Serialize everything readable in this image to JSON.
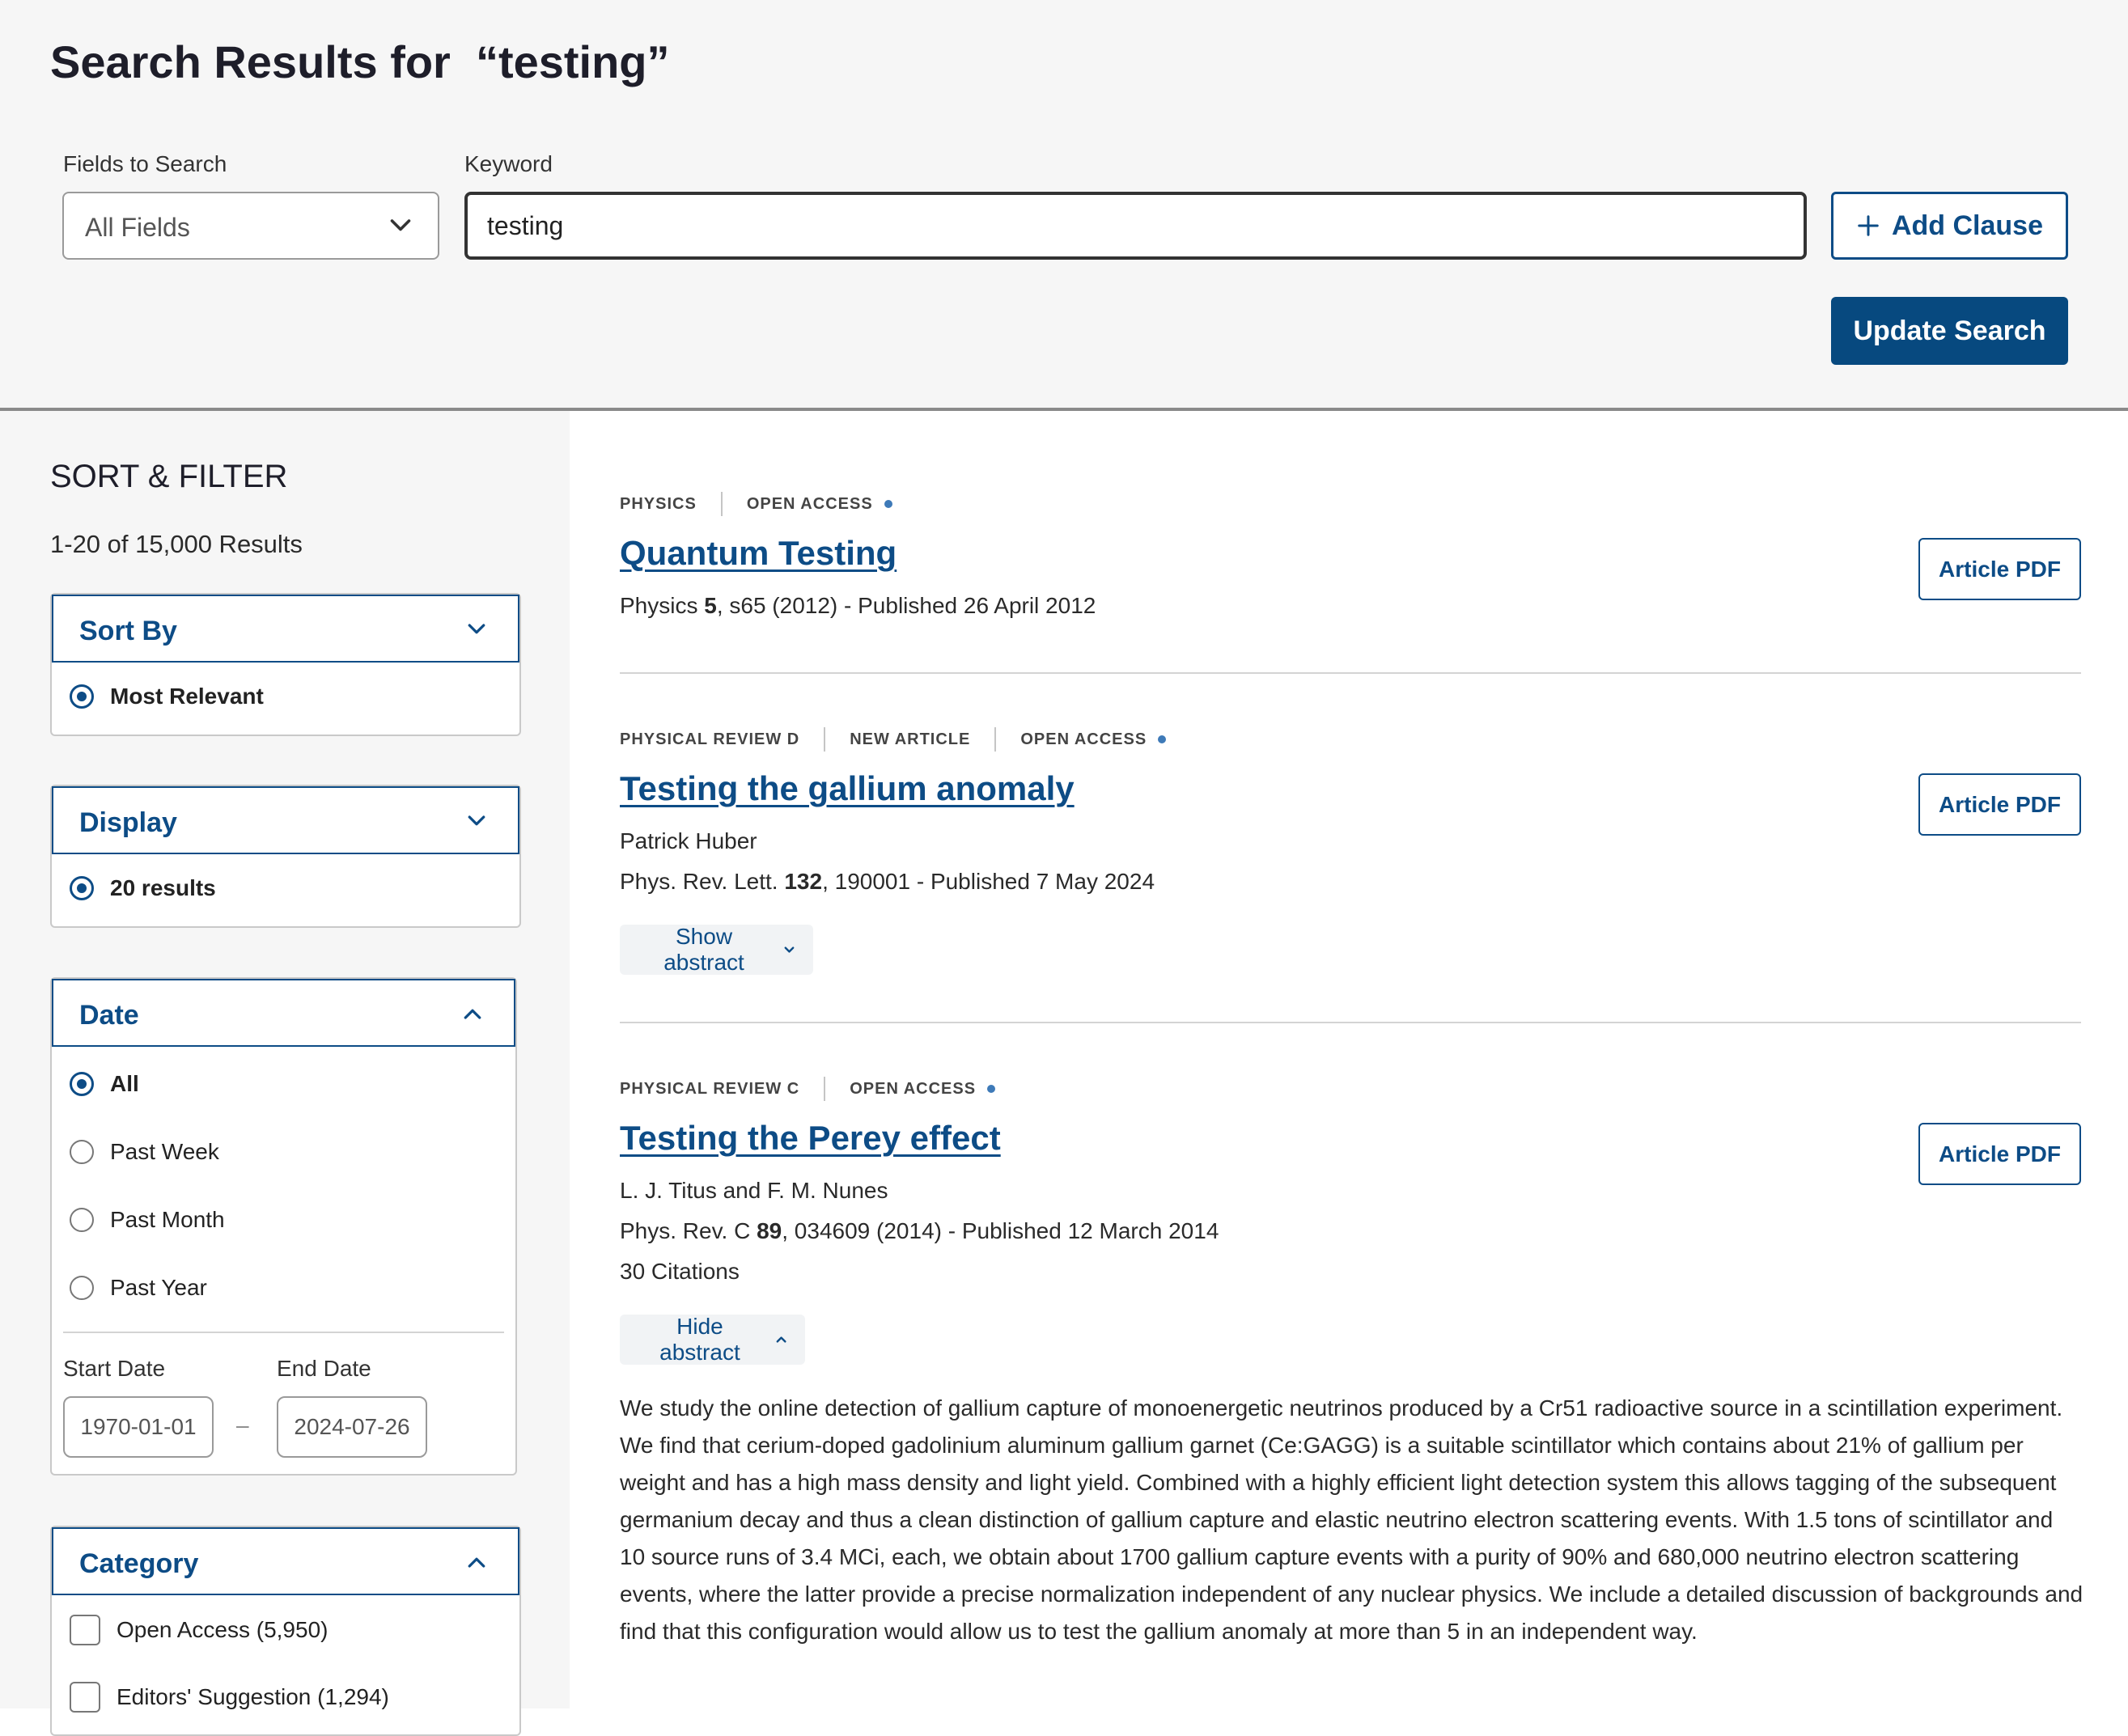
{
  "header": {
    "title": "Search Results for  “testing”",
    "fields_label": "Fields to Search",
    "fields_value": "All Fields",
    "keyword_label": "Keyword",
    "keyword_value": "testing",
    "add_clause": "Add Clause",
    "update_search": "Update Search"
  },
  "sidebar": {
    "title": "SORT & FILTER",
    "result_count": "1-20 of 15,000 Results",
    "sort": {
      "label": "Sort By",
      "option": "Most Relevant"
    },
    "display": {
      "label": "Display",
      "option": "20 results"
    },
    "date": {
      "label": "Date",
      "options": [
        "All",
        "Past Week",
        "Past Month",
        "Past Year"
      ],
      "selected": "All",
      "start_label": "Start Date",
      "end_label": "End Date",
      "start_value": "1970-01-01",
      "end_value": "2024-07-26",
      "range_sep": "–"
    },
    "category": {
      "label": "Category",
      "options": [
        "Open Access (5,950)",
        "Editors' Suggestion (1,294)"
      ]
    }
  },
  "results": [
    {
      "tags": [
        "PHYSICS",
        "OPEN ACCESS"
      ],
      "title": "Quantum Testing",
      "journal": "Physics ",
      "volume": "5",
      "citation": ", s65 (2012) - Published 26 April 2012",
      "pdf": "Article PDF"
    },
    {
      "tags": [
        "PHYSICAL REVIEW D",
        "NEW ARTICLE",
        "OPEN ACCESS"
      ],
      "title": "Testing the gallium anomaly",
      "authors": "Patrick Huber",
      "journal": "Phys. Rev. Lett. ",
      "volume": "132",
      "citation": ", 190001 - Published 7 May 2024",
      "abstract_toggle": "Show abstract",
      "pdf": "Article PDF"
    },
    {
      "tags": [
        "PHYSICAL REVIEW C",
        "OPEN ACCESS"
      ],
      "title": "Testing the Perey effect",
      "authors": "L. J. Titus and F. M. Nunes",
      "journal": "Phys. Rev. C ",
      "volume": "89",
      "citation": ", 034609 (2014) - Published 12 March 2014",
      "citations": "30 Citations",
      "abstract_toggle": "Hide abstract",
      "abstract": "We study the online detection of gallium capture of monoenergetic neutrinos produced by a Cr51 radioactive source in a scintillation experiment. We find that cerium-doped gadolinium aluminum gallium garnet (Ce:GAGG) is a suitable scintillator which contains about 21% of gallium per weight and has a high mass density and light yield. Combined with a highly efficient light detection system this allows tagging of the subsequent germanium decay and thus a clean distinction of gallium capture and elastic neutrino electron scattering events. With 1.5 tons of scintillator and 10 source runs of 3.4 MCi, each, we obtain about 1700 gallium capture events with a purity of 90% and 680,000 neutrino electron scattering events, where the latter provide a precise normalization independent of any nuclear physics. We include a detailed discussion of backgrounds and find that this configuration would allow us to test the gallium anomaly at more than 5 in an independent way.",
      "pdf": "Article PDF"
    }
  ]
}
